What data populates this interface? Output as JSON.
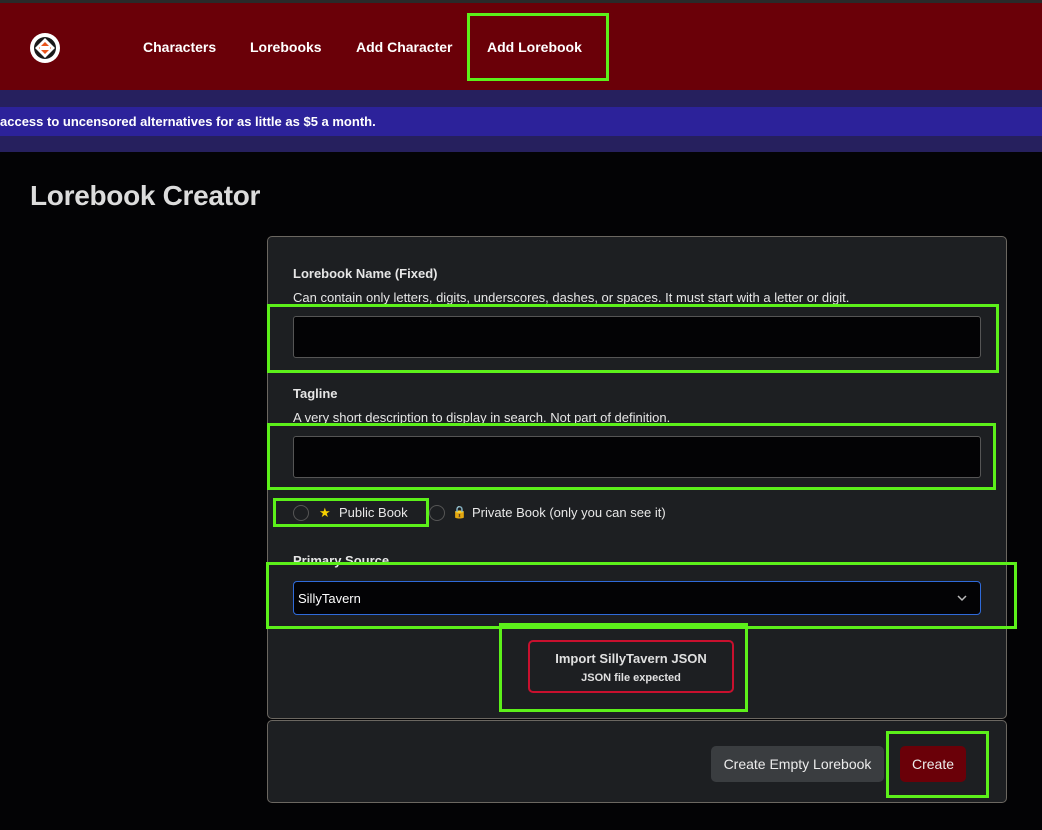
{
  "nav": {
    "items": [
      {
        "label": "Characters"
      },
      {
        "label": "Lorebooks"
      },
      {
        "label": "Add Character"
      },
      {
        "label": "Add Lorebook"
      }
    ]
  },
  "banner": {
    "text": "access to uncensored alternatives for as little as $5 a month."
  },
  "page": {
    "title": "Lorebook Creator"
  },
  "form": {
    "name_label": "Lorebook Name (Fixed)",
    "name_help": "Can contain only letters, digits, underscores, dashes, or spaces. It must start with a letter or digit.",
    "name_value": "",
    "tagline_label": "Tagline",
    "tagline_help": "A very short description to display in search. Not part of definition.",
    "tagline_value": "",
    "visibility": {
      "public_icon": "★",
      "public_label": "Public Book",
      "private_icon": "🔒",
      "private_label": "Private Book (only you can see it)",
      "selected": "none"
    },
    "source_label": "Primary Source",
    "source_value": "SillyTavern",
    "import_title": "Import SillyTavern JSON",
    "import_sub": "JSON file expected"
  },
  "actions": {
    "create_empty_label": "Create Empty Lorebook",
    "create_label": "Create"
  },
  "colors": {
    "nav_bg": "#6a0008",
    "banner_bg": "#2c229a",
    "highlight": "#5cf01a",
    "import_border": "#c8102e",
    "select_border": "#2f6ad9"
  },
  "icons": {
    "logo": "app-logo-icon",
    "star": "star-icon",
    "lock": "lock-icon",
    "chevron": "chevron-down-icon"
  }
}
